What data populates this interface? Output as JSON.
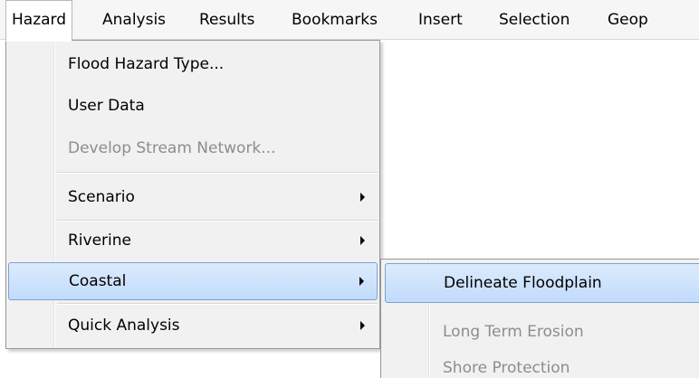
{
  "menubar": {
    "items": [
      {
        "label": "Hazard",
        "active": true
      },
      {
        "label": "Analysis"
      },
      {
        "label": "Results"
      },
      {
        "label": "Bookmarks"
      },
      {
        "label": "Insert"
      },
      {
        "label": "Selection"
      },
      {
        "label": "Geop"
      }
    ]
  },
  "hazard_menu": {
    "items": [
      {
        "label": "Flood Hazard Type...",
        "enabled": true
      },
      {
        "label": "User Data",
        "enabled": true
      },
      {
        "label": "Develop Stream Network...",
        "enabled": false
      },
      {
        "label": "Scenario",
        "enabled": true,
        "submenu": true
      },
      {
        "label": "Riverine",
        "enabled": true,
        "submenu": true
      },
      {
        "label": "Coastal",
        "enabled": true,
        "submenu": true,
        "highlighted": true
      },
      {
        "label": "Quick Analysis",
        "enabled": true,
        "submenu": true
      }
    ]
  },
  "coastal_submenu": {
    "items": [
      {
        "label": "Delineate Floodplain",
        "enabled": true,
        "highlighted": true
      },
      {
        "label": "Long Term Erosion",
        "enabled": false
      },
      {
        "label": "Shore Protection",
        "enabled": false
      }
    ]
  },
  "colors": {
    "highlight_fill": "#c1dbfc",
    "highlight_border": "#7da2ce",
    "disabled_text": "#8d8d8d",
    "menu_background": "#f1f1f1"
  },
  "icons": {
    "submenu_arrow": "chevron-right-icon"
  }
}
